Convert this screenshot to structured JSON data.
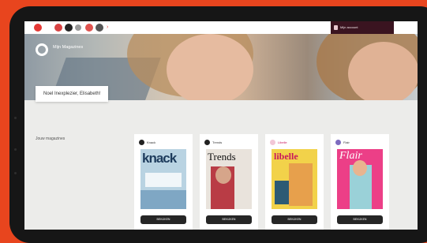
{
  "topbar": {
    "account_label": "Mijn account"
  },
  "hero": {
    "logo_text": "Mijn Magazines",
    "greeting": "Noel Inexplezier, Elisabeth!"
  },
  "section": {
    "label": "Jouw magazines"
  },
  "magazines": [
    {
      "brand": "Knack",
      "cover_title": "knack",
      "button": "BEKIJKEN",
      "cover_color": "#b9d3e2",
      "accent": "#1d3b5c"
    },
    {
      "brand": "Trends",
      "cover_title": "Trends",
      "button": "BEKIJKEN",
      "cover_color": "#e9e3dc",
      "accent": "#b01e2a"
    },
    {
      "brand": "Libelle",
      "cover_title": "libelle",
      "button": "BEKIJKEN",
      "cover_color": "#f2d24a",
      "accent": "#c9175c"
    },
    {
      "brand": "Flair",
      "cover_title": "Flair",
      "button": "BEKIJKEN",
      "cover_color": "#ec3f87",
      "accent": "#ffffff"
    }
  ],
  "colors": {
    "background": "#e8451e",
    "device": "#161616",
    "account_bg": "#3a1420",
    "button": "#262626"
  }
}
